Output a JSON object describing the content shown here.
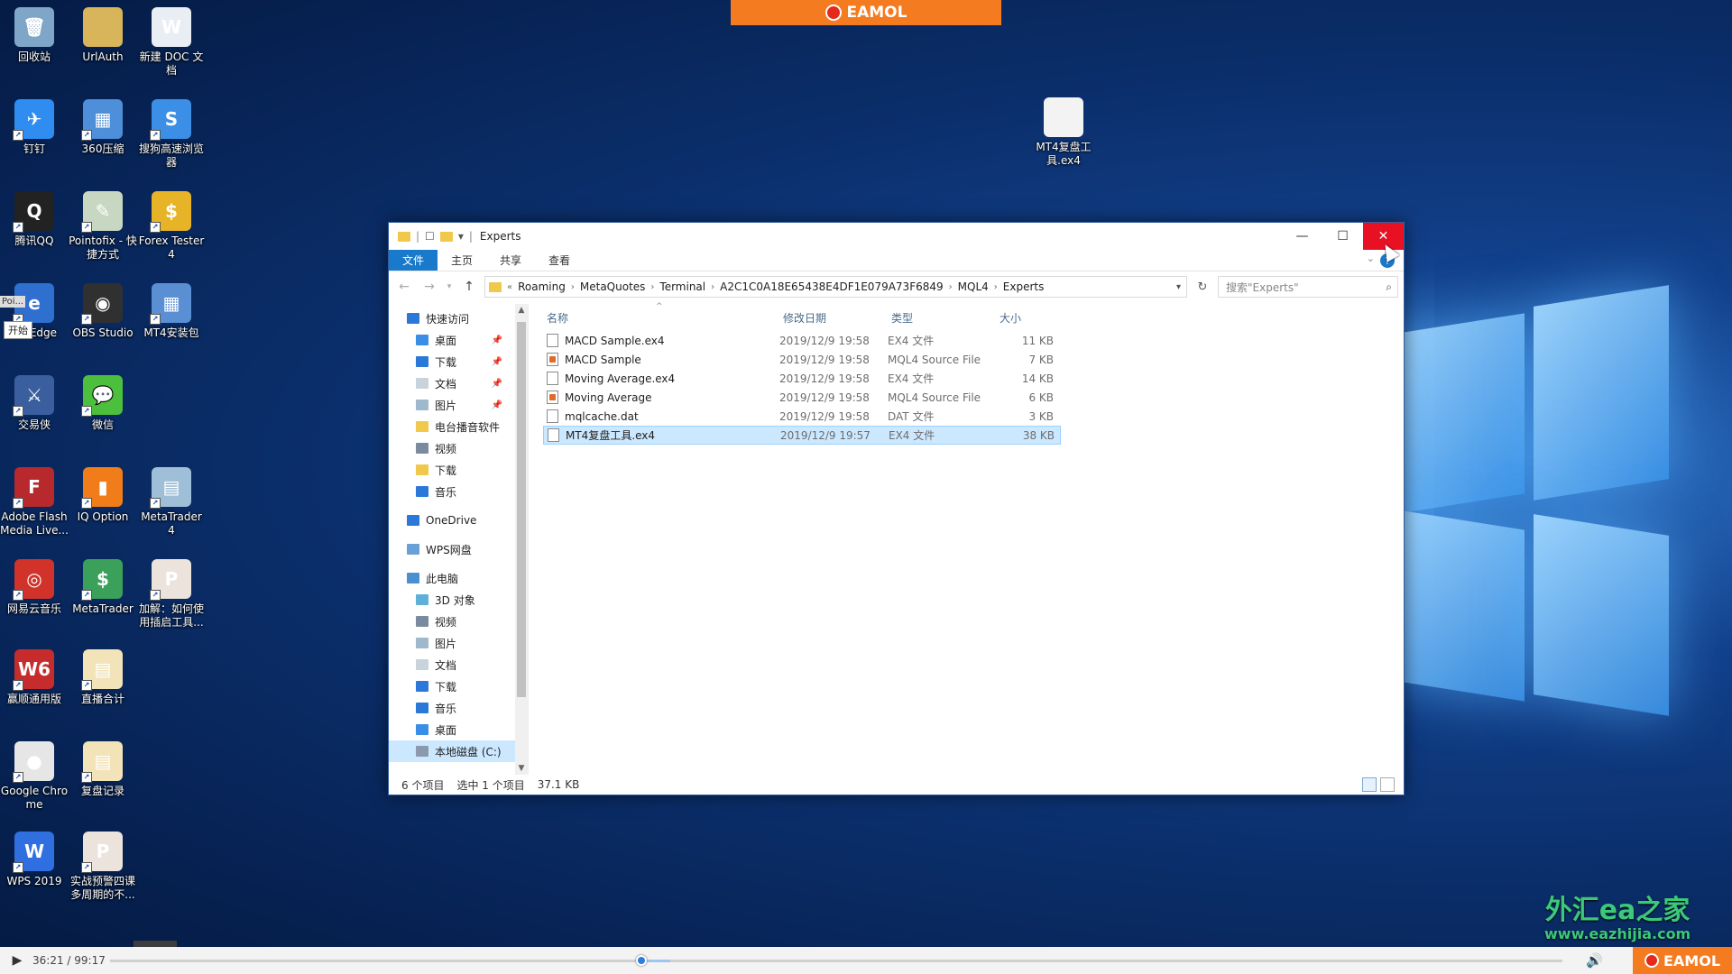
{
  "brand": {
    "name": "EAMOL"
  },
  "desktop": {
    "icons": [
      {
        "label": "回收站",
        "color": "#7fa6c9",
        "glyph": "🗑"
      },
      {
        "label": "UrlAuth",
        "color": "#d8b45a",
        "glyph": ""
      },
      {
        "label": "新建 DOC 文档",
        "color": "#e9eef5",
        "glyph": "W"
      },
      {
        "label": "钉钉",
        "color": "#2f8cf0",
        "glyph": "✈"
      },
      {
        "label": "360压缩",
        "color": "#4d8fd9",
        "glyph": "▦"
      },
      {
        "label": "搜狗高速浏览器",
        "color": "#3b8fe6",
        "glyph": "S"
      },
      {
        "label": "腾讯QQ",
        "color": "#222222",
        "glyph": "Q"
      },
      {
        "label": "Pointofix - 快捷方式",
        "color": "#c8d7c1",
        "glyph": "✎"
      },
      {
        "label": "Forex Tester 4",
        "color": "#e6b426",
        "glyph": "$"
      },
      {
        "label": "oft Edge",
        "color": "#2f6fcf",
        "glyph": "e"
      },
      {
        "label": "OBS Studio",
        "color": "#303030",
        "glyph": "◉"
      },
      {
        "label": "MT4安装包",
        "color": "#5b8fd4",
        "glyph": "▦"
      },
      {
        "label": "交易侠",
        "color": "#3b5f9e",
        "glyph": "⚔"
      },
      {
        "label": "微信",
        "color": "#4cbf3d",
        "glyph": "💬"
      },
      {
        "label": "Adobe Flash Media Live...",
        "color": "#b8292d",
        "glyph": "F"
      },
      {
        "label": "IQ Option",
        "color": "#f07c1a",
        "glyph": "▮"
      },
      {
        "label": "MetaTrader 4",
        "color": "#9fbfd8",
        "glyph": "▤"
      },
      {
        "label": "网易云音乐",
        "color": "#d1322a",
        "glyph": "◎"
      },
      {
        "label": "MetaTrader",
        "color": "#3aa05a",
        "glyph": "$"
      },
      {
        "label": "加解：如何使用插启工具...",
        "color": "#ebe3dc",
        "glyph": "P"
      },
      {
        "label": "赢顺通用版",
        "color": "#c62c2c",
        "glyph": "W6"
      },
      {
        "label": "直播合计",
        "color": "#f2e3b8",
        "glyph": "▤"
      },
      {
        "label": "Google Chrome",
        "color": "#e6e6e6",
        "glyph": "●"
      },
      {
        "label": "复盘记录",
        "color": "#f2e3b8",
        "glyph": "▤"
      },
      {
        "label": "WPS 2019",
        "color": "#2f6fe0",
        "glyph": "W"
      },
      {
        "label": "实战预警四课多周期的不...",
        "color": "#ebe3dc",
        "glyph": "P"
      },
      {
        "label": "MT4复盘工具.ex4",
        "color": "#f3f3f3",
        "glyph": ""
      }
    ],
    "start_hint": "开始",
    "partial_label": "Poi..."
  },
  "explorer": {
    "title": "Experts",
    "ribbon_tabs": [
      "文件",
      "主页",
      "共享",
      "查看"
    ],
    "breadcrumb": [
      "Roaming",
      "MetaQuotes",
      "Terminal",
      "A2C1C0A18E65438E4DF1E079A73F6849",
      "MQL4",
      "Experts"
    ],
    "breadcrumb_prefix": "«",
    "search_placeholder": "搜索\"Experts\"",
    "nav": [
      {
        "label": "快速访问",
        "color": "#2b78d8",
        "indent": 0,
        "pin": false
      },
      {
        "label": "桌面",
        "color": "#3a8ee6",
        "indent": 1,
        "pin": true
      },
      {
        "label": "下载",
        "color": "#2b78d8",
        "indent": 1,
        "pin": true
      },
      {
        "label": "文档",
        "color": "#c9d3dc",
        "indent": 1,
        "pin": true
      },
      {
        "label": "图片",
        "color": "#9fb8cc",
        "indent": 1,
        "pin": true
      },
      {
        "label": "电台播音软件",
        "color": "#f0c84c",
        "indent": 1,
        "pin": false
      },
      {
        "label": "视频",
        "color": "#7a8aa0",
        "indent": 1,
        "pin": false
      },
      {
        "label": "下载",
        "color": "#f0c84c",
        "indent": 1,
        "pin": false
      },
      {
        "label": "音乐",
        "color": "#2b78d8",
        "indent": 1,
        "pin": false
      },
      {
        "label": "OneDrive",
        "color": "#2b78d8",
        "indent": 0,
        "pin": false
      },
      {
        "label": "WPS网盘",
        "color": "#6aa0d8",
        "indent": 0,
        "pin": false
      },
      {
        "label": "此电脑",
        "color": "#4a90d0",
        "indent": 0,
        "pin": false
      },
      {
        "label": "3D 对象",
        "color": "#5fb0d8",
        "indent": 1,
        "pin": false
      },
      {
        "label": "视频",
        "color": "#7a8aa0",
        "indent": 1,
        "pin": false
      },
      {
        "label": "图片",
        "color": "#9fb8cc",
        "indent": 1,
        "pin": false
      },
      {
        "label": "文档",
        "color": "#c9d3dc",
        "indent": 1,
        "pin": false
      },
      {
        "label": "下载",
        "color": "#2b78d8",
        "indent": 1,
        "pin": false
      },
      {
        "label": "音乐",
        "color": "#2b78d8",
        "indent": 1,
        "pin": false
      },
      {
        "label": "桌面",
        "color": "#3a8ee6",
        "indent": 1,
        "pin": false
      },
      {
        "label": "本地磁盘 (C:)",
        "color": "#8a9aaa",
        "indent": 1,
        "pin": false,
        "selected": true
      }
    ],
    "columns": [
      "名称",
      "修改日期",
      "类型",
      "大小"
    ],
    "files": [
      {
        "name": "MACD Sample.ex4",
        "date": "2019/12/9 19:58",
        "type": "EX4 文件",
        "size": "11 KB",
        "icon": "file"
      },
      {
        "name": "MACD Sample",
        "date": "2019/12/9 19:58",
        "type": "MQL4 Source File",
        "size": "7 KB",
        "icon": "src"
      },
      {
        "name": "Moving Average.ex4",
        "date": "2019/12/9 19:58",
        "type": "EX4 文件",
        "size": "14 KB",
        "icon": "file"
      },
      {
        "name": "Moving Average",
        "date": "2019/12/9 19:58",
        "type": "MQL4 Source File",
        "size": "6 KB",
        "icon": "src"
      },
      {
        "name": "mqlcache.dat",
        "date": "2019/12/9 19:58",
        "type": "DAT 文件",
        "size": "3 KB",
        "icon": "file"
      },
      {
        "name": "MT4复盘工具.ex4",
        "date": "2019/12/9 19:57",
        "type": "EX4 文件",
        "size": "38 KB",
        "icon": "file",
        "selected": true
      }
    ],
    "status": {
      "count": "6 个项目",
      "selected": "选中 1 个项目",
      "size": "37.1 KB"
    }
  },
  "watermark": {
    "line1": "外汇ea之家",
    "line2": "www.eazhijia.com"
  },
  "player": {
    "time": "36:21 / 99:17",
    "progress": 0.366
  }
}
